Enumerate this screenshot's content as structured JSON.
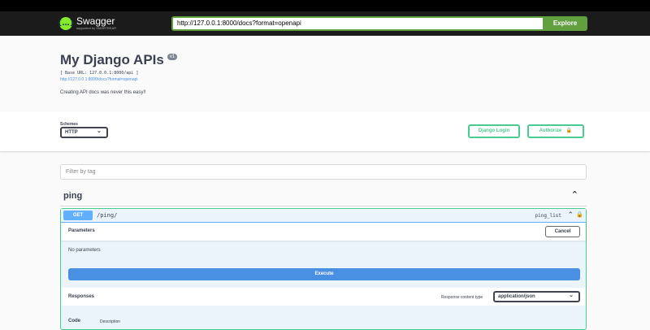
{
  "header": {
    "logo_text": "Swagger",
    "logo_subtext": "supported by SMARTBEAR",
    "url_value": "http://127.0.0.1:8000/docs?format=openapi",
    "explore_label": "Explore"
  },
  "info": {
    "title": "My Django APIs",
    "version": "v1",
    "base_url": "[ Base URL: 127.0.0.1:8000/api ]",
    "doc_link": "http://127.0.0.1:8000/docs?format=openapi",
    "description": "Creating API docs was never this easy!!"
  },
  "schemes": {
    "label": "Schemes",
    "selected": "HTTP",
    "django_login_label": "Django Login",
    "authorize_label": "Authorize"
  },
  "filter": {
    "placeholder": "Filter by tag"
  },
  "tag": {
    "name": "ping"
  },
  "operation": {
    "method": "GET",
    "path": "/ping/",
    "operation_id": "ping_list",
    "parameters_title": "Parameters",
    "cancel_label": "Cancel",
    "no_parameters": "No parameters",
    "execute_label": "Execute",
    "responses_title": "Responses",
    "content_type_label": "Response content type",
    "content_type_selected": "application/json",
    "code_label": "Code",
    "description_label": "Description"
  },
  "colors": {
    "topbar": "#1b1b1b",
    "explore_green": "#62a03f",
    "get_blue": "#61affe",
    "authorize_green": "#49cc90",
    "execute_blue": "#4990e2"
  }
}
